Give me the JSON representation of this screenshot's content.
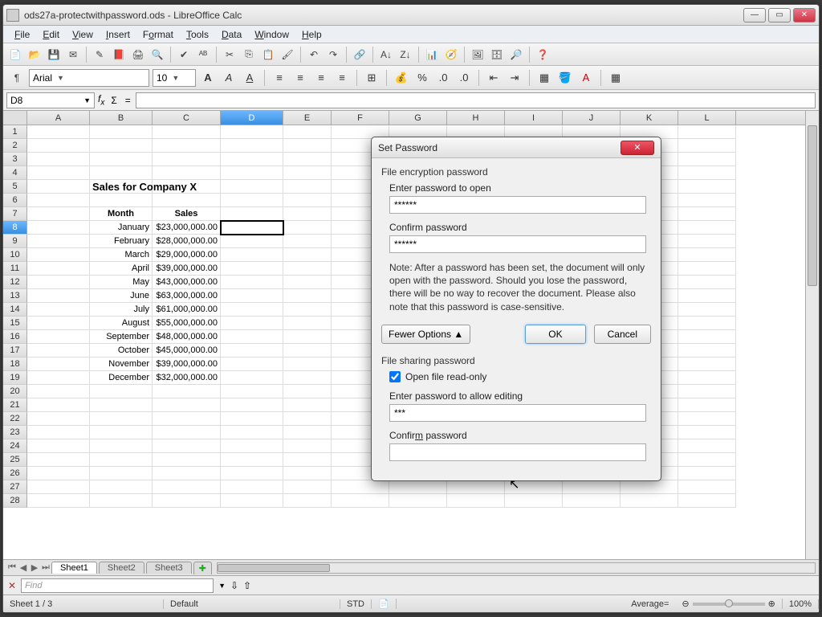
{
  "app": {
    "title": "ods27a-protectwithpassword.ods - LibreOffice Calc"
  },
  "menu": {
    "file": "File",
    "edit": "Edit",
    "view": "View",
    "insert": "Insert",
    "format": "Format",
    "tools": "Tools",
    "data": "Data",
    "window": "Window",
    "help": "Help"
  },
  "fmt": {
    "font": "Arial",
    "size": "10"
  },
  "namebox": "D8",
  "columns": [
    "A",
    "B",
    "C",
    "D",
    "E",
    "F",
    "G",
    "H",
    "I",
    "J",
    "K",
    "L"
  ],
  "sheet": {
    "title": "Sales for Company X",
    "head_month": "Month",
    "head_sales": "Sales",
    "rows": [
      {
        "m": "January",
        "s": "$23,000,000.00"
      },
      {
        "m": "February",
        "s": "$28,000,000.00"
      },
      {
        "m": "March",
        "s": "$29,000,000.00"
      },
      {
        "m": "April",
        "s": "$39,000,000.00"
      },
      {
        "m": "May",
        "s": "$43,000,000.00"
      },
      {
        "m": "June",
        "s": "$63,000,000.00"
      },
      {
        "m": "July",
        "s": "$61,000,000.00"
      },
      {
        "m": "August",
        "s": "$55,000,000.00"
      },
      {
        "m": "September",
        "s": "$48,000,000.00"
      },
      {
        "m": "October",
        "s": "$45,000,000.00"
      },
      {
        "m": "November",
        "s": "$39,000,000.00"
      },
      {
        "m": "December",
        "s": "$32,000,000.00"
      }
    ]
  },
  "tabs": {
    "s1": "Sheet1",
    "s2": "Sheet2",
    "s3": "Sheet3"
  },
  "find": {
    "placeholder": "Find"
  },
  "status": {
    "sheet": "Sheet 1 / 3",
    "style": "Default",
    "mode": "STD",
    "avg": "Average=",
    "zoom": "100%"
  },
  "dialog": {
    "title": "Set Password",
    "grp1": "File encryption password",
    "lbl_enter": "Enter password to open",
    "val_enter": "******",
    "lbl_confirm": "Confirm password",
    "val_confirm": "******",
    "note": "Note: After a password has been set, the document will only open with the password. Should you lose the password, there will be no way to recover the document. Please also note that this password is case-sensitive.",
    "fewer": "Fewer Options ▲",
    "ok": "OK",
    "cancel": "Cancel",
    "grp2": "File sharing password",
    "readonly": "Open file read-only",
    "lbl_edit": "Enter password to allow editing",
    "val_edit": "***",
    "lbl_confirm2": "Confirm password",
    "val_confirm2": ""
  }
}
